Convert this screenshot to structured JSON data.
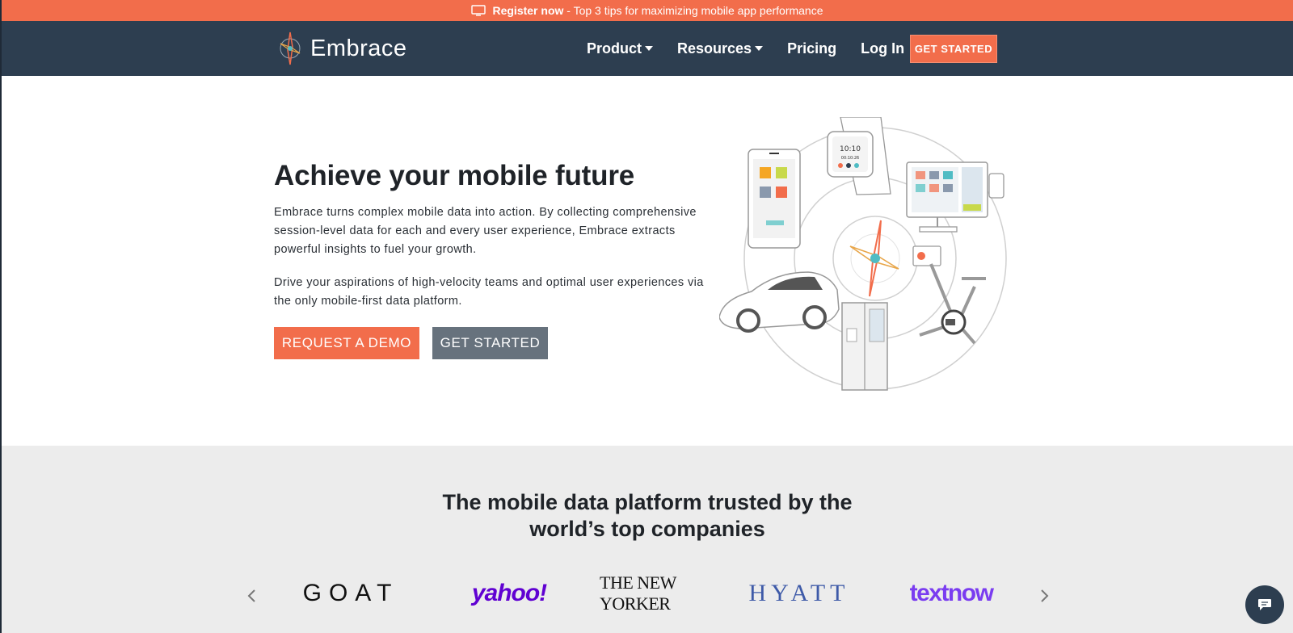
{
  "announcement": {
    "link_text": "Register now",
    "text": " - Top 3 tips for maximizing mobile app performance",
    "icon": "monitor-icon"
  },
  "header": {
    "logo_text": "Embrace",
    "nav": [
      {
        "label": "Product",
        "has_dropdown": true
      },
      {
        "label": "Resources",
        "has_dropdown": true
      },
      {
        "label": "Pricing",
        "has_dropdown": false
      },
      {
        "label": "Log In",
        "has_dropdown": false
      }
    ],
    "cta_label": "GET STARTED"
  },
  "hero": {
    "title": "Achieve your mobile future",
    "paragraph1": "Embrace turns complex mobile data into action. By collecting comprehensive session-level data for each and every user experience, Embrace extracts powerful insights to fuel your growth.",
    "paragraph2": "Drive your aspirations of high-velocity teams and optimal user experiences via the only mobile-first data platform.",
    "demo_button": "REQUEST A DEMO",
    "start_button": "GET STARTED",
    "watch_time": "10:10",
    "watch_date": "00:10:26"
  },
  "trusted": {
    "title_line1": "The mobile data platform trusted by the",
    "title_line2": "world’s top companies",
    "brands": [
      "GOAT",
      "yahoo!",
      "THE NEW YORKER",
      "HYATT",
      "textnow"
    ]
  },
  "colors": {
    "accent": "#f26d4b",
    "header_bg": "#2d3e50",
    "secondary_button": "#67727d",
    "section_bg": "#ececec"
  }
}
